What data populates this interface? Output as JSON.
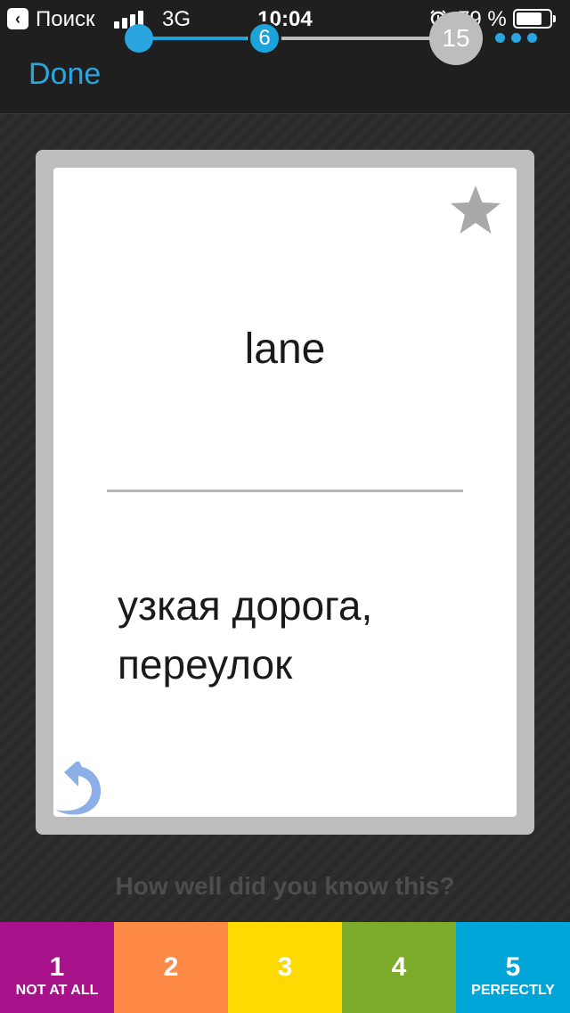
{
  "status_bar": {
    "back_label": "Поиск",
    "network": "3G",
    "time": "10:04",
    "battery": "79 %",
    "battery_level": 0.79,
    "signal_bars": 4
  },
  "nav": {
    "done_label": "Done",
    "progress_start": 1,
    "progress_current": "6",
    "progress_total": "15",
    "more_icon": "more-dots-icon"
  },
  "card": {
    "term": "lane",
    "definition": "узкая дорога, переулок",
    "star_icon": "star-icon",
    "flip_icon": "flip-card-icon"
  },
  "prompt": "How well did you know this?",
  "ratings": [
    {
      "value": "1",
      "label": "NOT AT ALL",
      "color": "#a7128a"
    },
    {
      "value": "2",
      "label": "",
      "color": "#ff8a48"
    },
    {
      "value": "3",
      "label": "",
      "color": "#ffda00"
    },
    {
      "value": "4",
      "label": "",
      "color": "#7dac2d"
    },
    {
      "value": "5",
      "label": "PERFECTLY",
      "color": "#00a5d8"
    }
  ],
  "colors": {
    "accent": "#2aa5e0",
    "background": "#2b2b2b",
    "card_frame": "#bdbdbd"
  }
}
